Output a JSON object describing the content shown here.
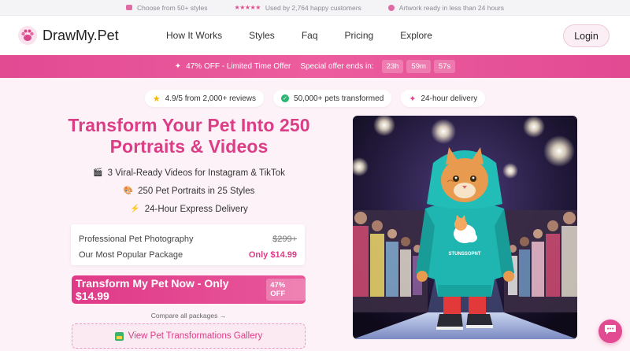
{
  "topstrip": {
    "item1": "Choose from 50+ styles",
    "stars": "★★★★★",
    "item2": "Used by 2,764 happy customers",
    "item3": "Artwork ready in less than 24 hours"
  },
  "nav": {
    "brand": "DrawMy.Pet",
    "links": [
      "How It Works",
      "Styles",
      "Faq",
      "Pricing",
      "Explore"
    ],
    "login": "Login"
  },
  "promo": {
    "offer": "47% OFF - Limited Time Offer",
    "ends_label": "Special offer ends in:",
    "hours": "23h",
    "minutes": "59m",
    "seconds": "57s"
  },
  "trust": {
    "reviews": "4.9/5 from 2,000+ reviews",
    "pets": "50,000+ pets transformed",
    "delivery": "24-hour delivery"
  },
  "hero": {
    "headline": "Transform Your Pet Into 250 Portraits & Videos",
    "features": [
      {
        "icon": "🎬",
        "text": "3 Viral-Ready Videos for Instagram & TikTok"
      },
      {
        "icon": "🎨",
        "text": "250 Pet Portraits in 25 Styles"
      },
      {
        "icon": "⚡",
        "text": "24-Hour Express Delivery"
      }
    ],
    "image_label": "STUNSSOPNT"
  },
  "pricing": {
    "row1_label": "Professional Pet Photography",
    "row1_price": "$299+",
    "row2_label": "Our Most Popular Package",
    "row2_price": "Only $14.99"
  },
  "cta": {
    "label": "Transform My Pet Now - Only $14.99",
    "badge": "47% OFF"
  },
  "compare_link": "Compare all packages →",
  "gallery_button": "View Pet Transformations Gallery",
  "colors": {
    "accent": "#dc3d87",
    "promo": "#e24a92",
    "background": "#fdf2f7"
  }
}
